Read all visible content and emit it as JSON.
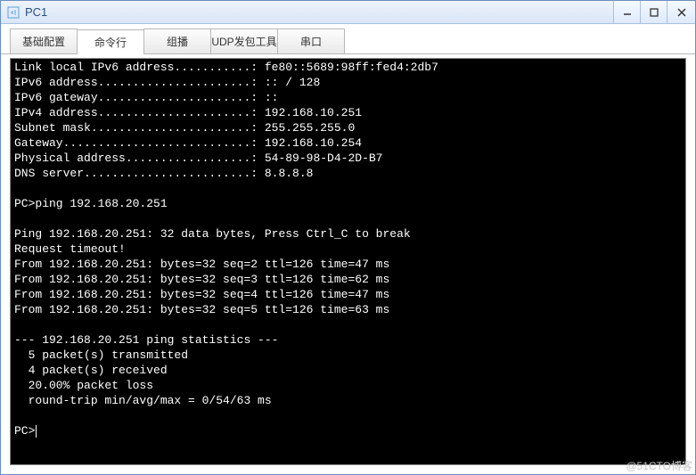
{
  "window": {
    "title": "PC1"
  },
  "tabs": [
    {
      "label": "基础配置"
    },
    {
      "label": "命令行"
    },
    {
      "label": "组播"
    },
    {
      "label": "UDP发包工具"
    },
    {
      "label": "串口"
    }
  ],
  "active_tab_index": 1,
  "terminal": {
    "config_lines": [
      "Link local IPv6 address...........: fe80::5689:98ff:fed4:2db7",
      "IPv6 address......................: :: / 128",
      "IPv6 gateway......................: ::",
      "IPv4 address......................: 192.168.10.251",
      "Subnet mask.......................: 255.255.255.0",
      "Gateway...........................: 192.168.10.254",
      "Physical address..................: 54-89-98-D4-2D-B7",
      "DNS server........................: 8.8.8.8"
    ],
    "prompt1": "PC>ping 192.168.20.251",
    "ping_header": "Ping 192.168.20.251: 32 data bytes, Press Ctrl_C to break",
    "ping_replies": [
      "Request timeout!",
      "From 192.168.20.251: bytes=32 seq=2 ttl=126 time=47 ms",
      "From 192.168.20.251: bytes=32 seq=3 ttl=126 time=62 ms",
      "From 192.168.20.251: bytes=32 seq=4 ttl=126 time=47 ms",
      "From 192.168.20.251: bytes=32 seq=5 ttl=126 time=63 ms"
    ],
    "stats_header": "--- 192.168.20.251 ping statistics ---",
    "stats_lines": [
      "  5 packet(s) transmitted",
      "  4 packet(s) received",
      "  20.00% packet loss",
      "  round-trip min/avg/max = 0/54/63 ms"
    ],
    "prompt2": "PC>"
  },
  "watermark": "@51CTO博客"
}
